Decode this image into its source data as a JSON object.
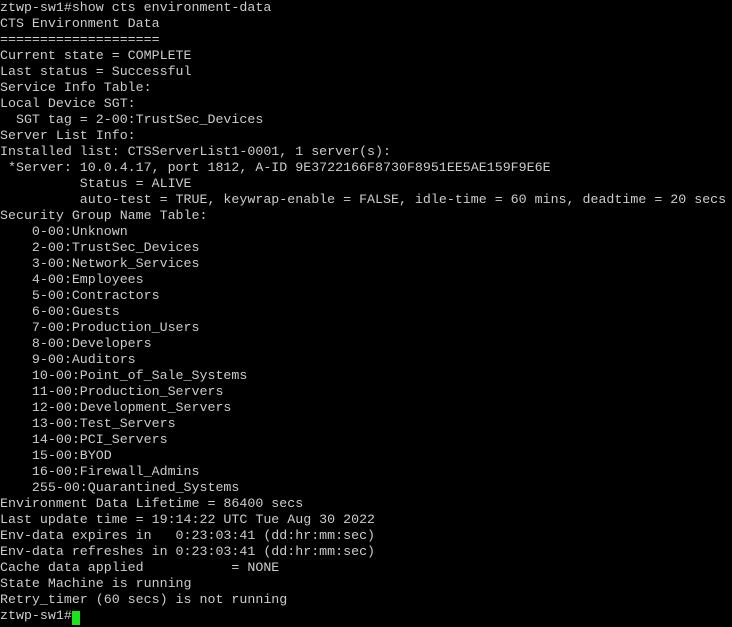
{
  "terminal": {
    "colors": {
      "background": "#000000",
      "foreground": "#cccccc",
      "cursor": "#19e619"
    },
    "prompt": "ztwp-sw1#",
    "command": "show cts environment-data",
    "lines": [
      "ztwp-sw1#show cts environment-data",
      "CTS Environment Data",
      "====================",
      "Current state = COMPLETE",
      "Last status = Successful",
      "Service Info Table:",
      "Local Device SGT:",
      "  SGT tag = 2-00:TrustSec_Devices",
      "Server List Info:",
      "Installed list: CTSServerList1-0001, 1 server(s):",
      " *Server: 10.0.4.17, port 1812, A-ID 9E3722166F8730F8951EE5AE159F9E6E",
      "          Status = ALIVE",
      "          auto-test = TRUE, keywrap-enable = FALSE, idle-time = 60 mins, deadtime = 20 secs",
      "Security Group Name Table:",
      "    0-00:Unknown",
      "    2-00:TrustSec_Devices",
      "    3-00:Network_Services",
      "    4-00:Employees",
      "    5-00:Contractors",
      "    6-00:Guests",
      "    7-00:Production_Users",
      "    8-00:Developers",
      "    9-00:Auditors",
      "    10-00:Point_of_Sale_Systems",
      "    11-00:Production_Servers",
      "    12-00:Development_Servers",
      "    13-00:Test_Servers",
      "    14-00:PCI_Servers",
      "    15-00:BYOD",
      "    16-00:Firewall_Admins",
      "    255-00:Quarantined_Systems",
      "Environment Data Lifetime = 86400 secs",
      "Last update time = 19:14:22 UTC Tue Aug 30 2022",
      "Env-data expires in   0:23:03:41 (dd:hr:mm:sec)",
      "Env-data refreshes in 0:23:03:41 (dd:hr:mm:sec)",
      "Cache data applied           = NONE",
      "State Machine is running",
      "Retry_timer (60 secs) is not running"
    ],
    "sgt_table": [
      {
        "tag": "0-00",
        "name": "Unknown"
      },
      {
        "tag": "2-00",
        "name": "TrustSec_Devices"
      },
      {
        "tag": "3-00",
        "name": "Network_Services"
      },
      {
        "tag": "4-00",
        "name": "Employees"
      },
      {
        "tag": "5-00",
        "name": "Contractors"
      },
      {
        "tag": "6-00",
        "name": "Guests"
      },
      {
        "tag": "7-00",
        "name": "Production_Users"
      },
      {
        "tag": "8-00",
        "name": "Developers"
      },
      {
        "tag": "9-00",
        "name": "Auditors"
      },
      {
        "tag": "10-00",
        "name": "Point_of_Sale_Systems"
      },
      {
        "tag": "11-00",
        "name": "Production_Servers"
      },
      {
        "tag": "12-00",
        "name": "Development_Servers"
      },
      {
        "tag": "13-00",
        "name": "Test_Servers"
      },
      {
        "tag": "14-00",
        "name": "PCI_Servers"
      },
      {
        "tag": "15-00",
        "name": "BYOD"
      },
      {
        "tag": "16-00",
        "name": "Firewall_Admins"
      },
      {
        "tag": "255-00",
        "name": "Quarantined_Systems"
      }
    ],
    "fields": {
      "current_state": "COMPLETE",
      "last_status": "Successful",
      "local_device_sgt": "2-00:TrustSec_Devices",
      "installed_list": "CTSServerList1-0001",
      "server_count": "1 server(s)",
      "server_ip": "10.0.4.17",
      "server_port": "1812",
      "server_aid": "9E3722166F8730F8951EE5AE159F9E6E",
      "server_status": "ALIVE",
      "auto_test": "TRUE",
      "keywrap_enable": "FALSE",
      "idle_time": "60 mins",
      "deadtime": "20 secs",
      "env_data_lifetime": "86400 secs",
      "last_update_time": "19:14:22 UTC Tue Aug 30 2022",
      "env_data_expires_in": "0:23:03:41 (dd:hr:mm:sec)",
      "env_data_refreshes_in": "0:23:03:41 (dd:hr:mm:sec)",
      "cache_data_applied": "NONE",
      "state_machine": "State Machine is running",
      "retry_timer": "Retry_timer (60 secs) is not running"
    }
  }
}
